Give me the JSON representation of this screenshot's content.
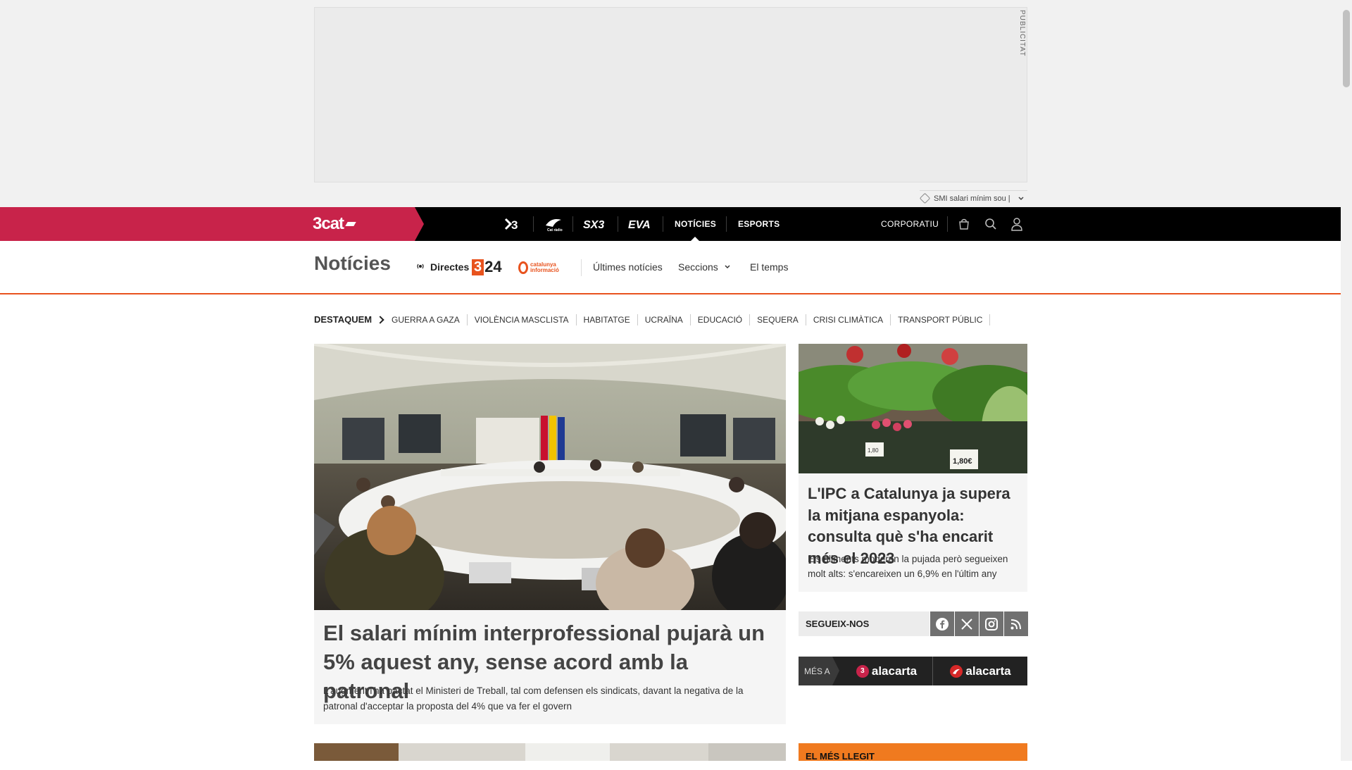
{
  "ad": {
    "label": "PUBLICITAT"
  },
  "trending_tag": "SMI salari mínim sou |",
  "brand": {
    "name": "3cat"
  },
  "channels": [
    {
      "name": "3",
      "icon": "tv3-logo"
    },
    {
      "name": "Cat ràdio",
      "icon": "catradio-logo"
    },
    {
      "name": "SX3",
      "icon": "sx3-logo"
    },
    {
      "name": "EVA",
      "icon": "eva-logo"
    }
  ],
  "top_nav": {
    "noticies": "NOTÍCIES",
    "esports": "ESPORTS",
    "corporatiu": "CORPORATIU"
  },
  "section": {
    "title": "Notícies",
    "directes": "Directes",
    "logo_324": "24",
    "logo_324_prefix": "3",
    "logo_ci": "catalunya informació",
    "links": [
      "Últimes notícies",
      "Seccions",
      "El temps"
    ]
  },
  "destaquem": {
    "label": "DESTAQUEM",
    "tags": [
      "GUERRA A GAZA",
      "VIOLÈNCIA MASCLISTA",
      "HABITATGE",
      "UCRAÏNA",
      "EDUCACIÓ",
      "SEQUERA",
      "CRISI CLIMÀTICA",
      "TRANSPORT PÚBLIC"
    ]
  },
  "main_article": {
    "title": "El salari mínim interprofessional pujarà un 5% aquest any, sense acord amb la patronal",
    "description": "L'augment l'ha pactat el Ministeri de Treball, tal com defensen els sindicats, davant la negativa de la patronal d'acceptar la proposta del 4% que va fer el govern"
  },
  "side_article": {
    "title": "L'IPC a Catalunya ja supera la mitjana espanyola: consulta què s'ha encarit més el 2023",
    "description": "Els aliments moderen la pujada però segueixen molt alts: s'encareixen un 6,9% en l'últim any",
    "price_tags": [
      "1,80",
      "1,80€"
    ]
  },
  "follow": {
    "label": "SEGUEIX-NOS",
    "networks": [
      "facebook-icon",
      "x-icon",
      "instagram-icon",
      "rss-icon"
    ]
  },
  "alacarta": {
    "label": "MÉS A",
    "items": [
      {
        "badge": "3",
        "text": "alacarta"
      },
      {
        "badge": "",
        "text": "alacarta"
      }
    ]
  },
  "most_read": {
    "label": "EL MÉS LLEGIT"
  },
  "colors": {
    "brand": "#c8234a",
    "accent": "#e8531e",
    "topbar": "#000000",
    "most_read": "#f07a1f"
  }
}
